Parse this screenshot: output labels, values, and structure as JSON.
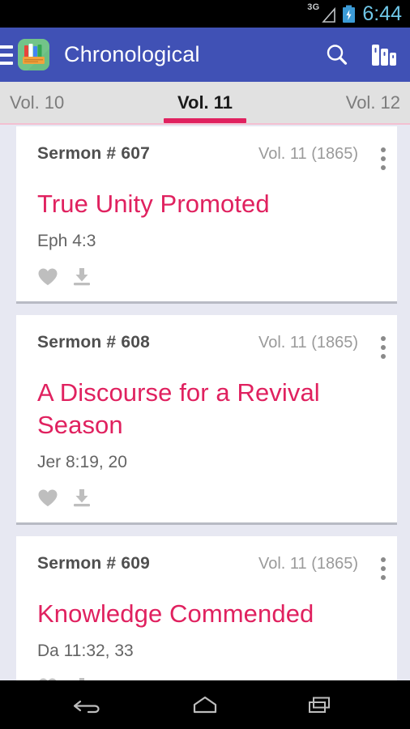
{
  "status_bar": {
    "network_label": "3G",
    "network_icon": "signal-triangle-icon",
    "battery_icon": "battery-charging-icon",
    "time": "6:44",
    "time_color": "#6FC7E8"
  },
  "toolbar": {
    "menu_icon": "hamburger-menu-icon",
    "app_icon": "app-logo-icon",
    "title": "Chronological",
    "search_icon": "search-icon",
    "volumes_icon": "books-shelf-icon",
    "background_color": "#4051B5"
  },
  "tabs": {
    "items": [
      {
        "label": "Vol. 10",
        "active": false
      },
      {
        "label": "Vol. 11",
        "active": true
      },
      {
        "label": "Vol. 12",
        "active": false
      }
    ],
    "indicator_color": "#E0215F"
  },
  "list": {
    "cards": [
      {
        "number": "Sermon # 607",
        "volume": "Vol. 11 (1865)",
        "title": "True Unity Promoted",
        "reference": "Eph 4:3",
        "favorite_icon": "heart-icon",
        "download_icon": "download-icon",
        "overflow_icon": "overflow-menu-icon"
      },
      {
        "number": "Sermon # 608",
        "volume": "Vol. 11 (1865)",
        "title": "A Discourse for a Revival Season",
        "reference": "Jer 8:19, 20",
        "favorite_icon": "heart-icon",
        "download_icon": "download-icon",
        "overflow_icon": "overflow-menu-icon"
      },
      {
        "number": "Sermon # 609",
        "volume": "Vol. 11 (1865)",
        "title": "Knowledge Commended",
        "reference": "Da 11:32, 33",
        "favorite_icon": "heart-icon",
        "download_icon": "download-icon",
        "overflow_icon": "overflow-menu-icon"
      }
    ],
    "title_color": "#E0215F"
  },
  "nav_bar": {
    "back_icon": "back-icon",
    "home_icon": "home-icon",
    "recents_icon": "recent-apps-icon"
  }
}
